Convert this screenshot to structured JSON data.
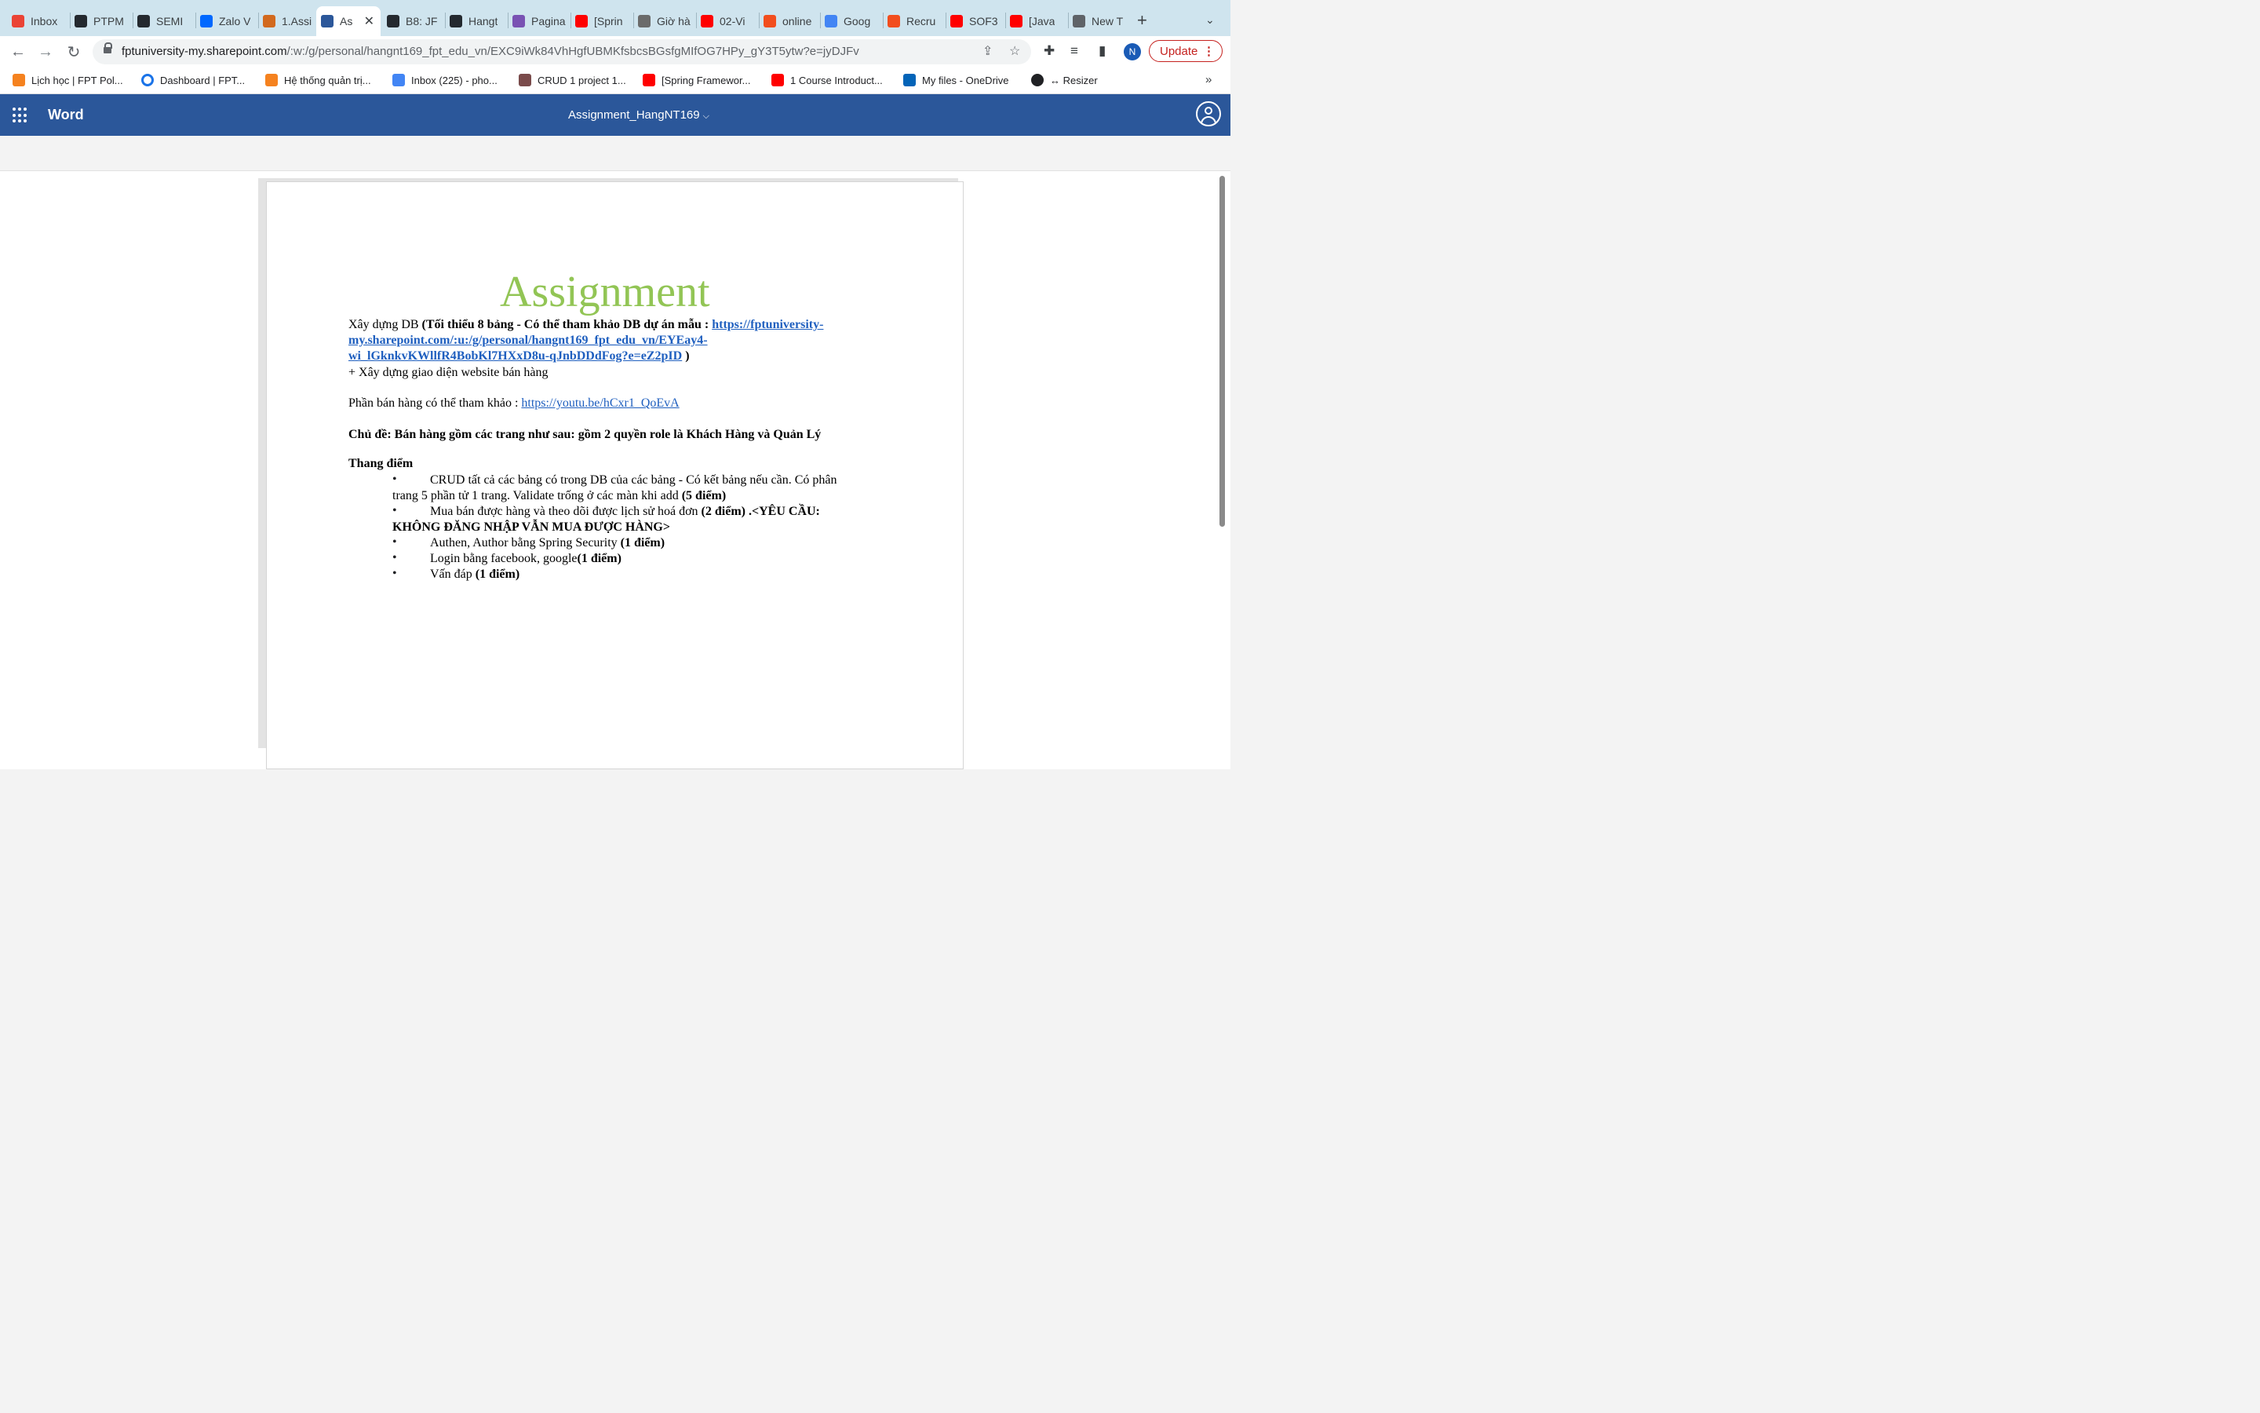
{
  "tabs": [
    {
      "label": "Inbox",
      "icon": "gmail-icon",
      "color": "#ea4335"
    },
    {
      "label": "PTPM",
      "icon": "github-icon",
      "color": "#24292f"
    },
    {
      "label": "SEMI",
      "icon": "github-icon",
      "color": "#24292f"
    },
    {
      "label": "Zalo V",
      "icon": "zalo-icon",
      "color": "#0068ff"
    },
    {
      "label": "1.Assi",
      "icon": "classroom-icon",
      "color": "#d2691e"
    },
    {
      "label": "As",
      "icon": "word-icon",
      "color": "#2b579a"
    },
    {
      "label": "B8: JF",
      "icon": "github-icon",
      "color": "#24292f"
    },
    {
      "label": "Hangt",
      "icon": "github-icon",
      "color": "#24292f"
    },
    {
      "label": "Pagina",
      "icon": "bootstrap-icon",
      "color": "#7952b3"
    },
    {
      "label": "[Sprin",
      "icon": "youtube-icon",
      "color": "#ff0000"
    },
    {
      "label": "Giờ hà",
      "icon": "chatgpt-icon",
      "color": "#6b6b6b"
    },
    {
      "label": "02-Vi",
      "icon": "youtube-icon",
      "color": "#ff0000"
    },
    {
      "label": "online",
      "icon": "figma-icon",
      "color": "#f24e1e"
    },
    {
      "label": "Goog",
      "icon": "google-translate-icon",
      "color": "#4285f4"
    },
    {
      "label": "Recru",
      "icon": "figma-icon",
      "color": "#f24e1e"
    },
    {
      "label": "SOF3",
      "icon": "youtube-icon",
      "color": "#ff0000"
    },
    {
      "label": "[Java",
      "icon": "youtube-icon",
      "color": "#ff0000"
    },
    {
      "label": "New T",
      "icon": "chrome-icon",
      "color": "#5f6368"
    }
  ],
  "url": {
    "host": "fptuniversity-my.sharepoint.com",
    "path": "/:w:/g/personal/hangnt169_fpt_edu_vn/EXC9iWk84VhHgfUBMKfsbcsBGsfgMIfOG7HPy_gY3T5ytw?e=jyDJFv"
  },
  "profile_initial": "N",
  "update_label": "Update",
  "bookmarks": [
    {
      "label": "Lịch học | FPT Pol...",
      "icon": "fpt-icon",
      "color": "#f5821f"
    },
    {
      "label": "Dashboard | FPT...",
      "icon": "circle-icon",
      "color": "#1a73e8"
    },
    {
      "label": "Hệ thống quản trị...",
      "icon": "fpt-icon",
      "color": "#f5821f"
    },
    {
      "label": "Inbox (225) - pho...",
      "icon": "google-icon",
      "color": "#4285f4"
    },
    {
      "label": "CRUD 1 project 1...",
      "icon": "thumbnail-icon",
      "color": "#7a4b4b"
    },
    {
      "label": "[Spring Framewor...",
      "icon": "youtube-icon",
      "color": "#ff0000"
    },
    {
      "label": "1 Course Introduct...",
      "icon": "youtube-icon",
      "color": "#ff0000"
    },
    {
      "label": "My files - OneDrive",
      "icon": "onedrive-icon",
      "color": "#0364b8"
    },
    {
      "label": "↔ Resizer",
      "icon": "globe-icon",
      "color": "#202124"
    }
  ],
  "bookmarks_more": "»",
  "word": {
    "app_name": "Word",
    "doc_title": "Assignment_HangNT169",
    "chevron": "⌵"
  },
  "doc": {
    "title": "Assignment",
    "db_prefix": "Xây dựng DB ",
    "db_bold": "(Tối thiểu 8 bảng - Có thể tham khảo DB dự án mẫu : ",
    "db_link1": "https://fptuniversity-",
    "db_link2": "my.sharepoint.com/:u:/g/personal/hangnt169_fpt_edu_vn/EYEay4-",
    "db_link3": "wi_lGknkvKWllfR4BobKl7HXxD8u-qJnbDDdFog?e=eZ2pID",
    "db_close": " )",
    "ui_line": "+ Xây dựng giao diện website bán hàng",
    "sales_prefix": "Phần bán hàng có thể tham khảo : ",
    "sales_link": "https://youtu.be/hCxr1_QoEvA",
    "topic": "Chủ đề: Bán hàng gồm các trang như sau:  gồm 2 quyền role là Khách Hàng và Quản Lý",
    "grading_heading": "Thang điểm",
    "bullet_glyph": "•",
    "b1_line1": "CRUD tất cả các bảng có trong DB của các bảng - Có kết bảng nếu cần. Có phân",
    "b1_line2_normal": "trang 5 phần tử 1 trang. Validate trống ở các màn khi add ",
    "b1_line2_bold": "(5 điểm)",
    "b2_line1_normal": "Mua bán được hàng và theo dõi được lịch sử hoá đơn ",
    "b2_line1_bold": "(2 điểm)",
    "b2_line1_tail": " .<YÊU CẦU:",
    "b2_line2": "KHÔNG ĐĂNG NHẬP VẪN MUA ĐƯỢC HÀNG>",
    "b3_normal": "Authen, Author bằng Spring Security ",
    "b3_bold": "(1 điểm)",
    "b4_normal": "Login bằng facebook, google",
    "b4_bold": "(1 điểm)",
    "b5_normal": "Vấn đáp ",
    "b5_bold": "(1 điểm)"
  }
}
